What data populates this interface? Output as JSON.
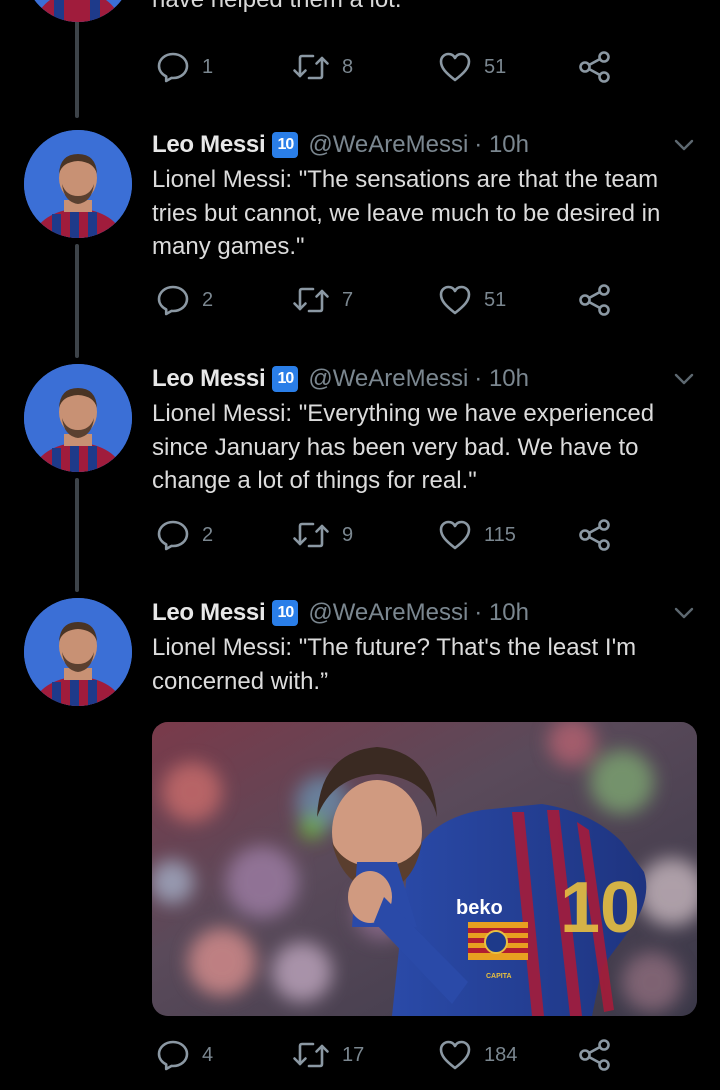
{
  "partial_tweet": {
    "text": "have helped them a lot.",
    "actions": {
      "replies": "1",
      "retweets": "8",
      "likes": "51"
    }
  },
  "tweets": [
    {
      "name": "Leo Messi",
      "badge": "10",
      "handle": "@WeAreMessi",
      "time": "· 10h",
      "lines": [
        "Lionel Messi: \"The sensations are that the team",
        "tries but cannot, we leave much to be desired in",
        "many games.\""
      ],
      "actions": {
        "replies": "2",
        "retweets": "7",
        "likes": "51"
      }
    },
    {
      "name": "Leo Messi",
      "badge": "10",
      "handle": "@WeAreMessi",
      "time": "· 10h",
      "lines": [
        "Lionel Messi: \"Everything we have experienced",
        "since January has been very bad. We have to",
        "change a lot of things for real.\""
      ],
      "actions": {
        "replies": "2",
        "retweets": "9",
        "likes": "115"
      }
    },
    {
      "name": "Leo Messi",
      "badge": "10",
      "handle": "@WeAreMessi",
      "time": "· 10h",
      "lines": [
        "Lionel Messi: \"The future? That's the least I'm",
        "concerned with.”"
      ],
      "media": {
        "shirt_sponsor": "beko",
        "armband": "CAPITA",
        "shirt_number": "10"
      },
      "actions": {
        "replies": "4",
        "retweets": "17",
        "likes": "184"
      }
    }
  ],
  "icons": {
    "reply": "reply-icon",
    "retweet": "retweet-icon",
    "like": "heart-icon",
    "share": "share-icon",
    "menu": "chevron-down-icon"
  },
  "colors": {
    "background": "#000000",
    "text": "#d9d9d9",
    "muted": "#7b8790",
    "badge": "#2a7ee8",
    "thread_line": "#3d4349",
    "avatar_bg": "#3b6fd6"
  }
}
